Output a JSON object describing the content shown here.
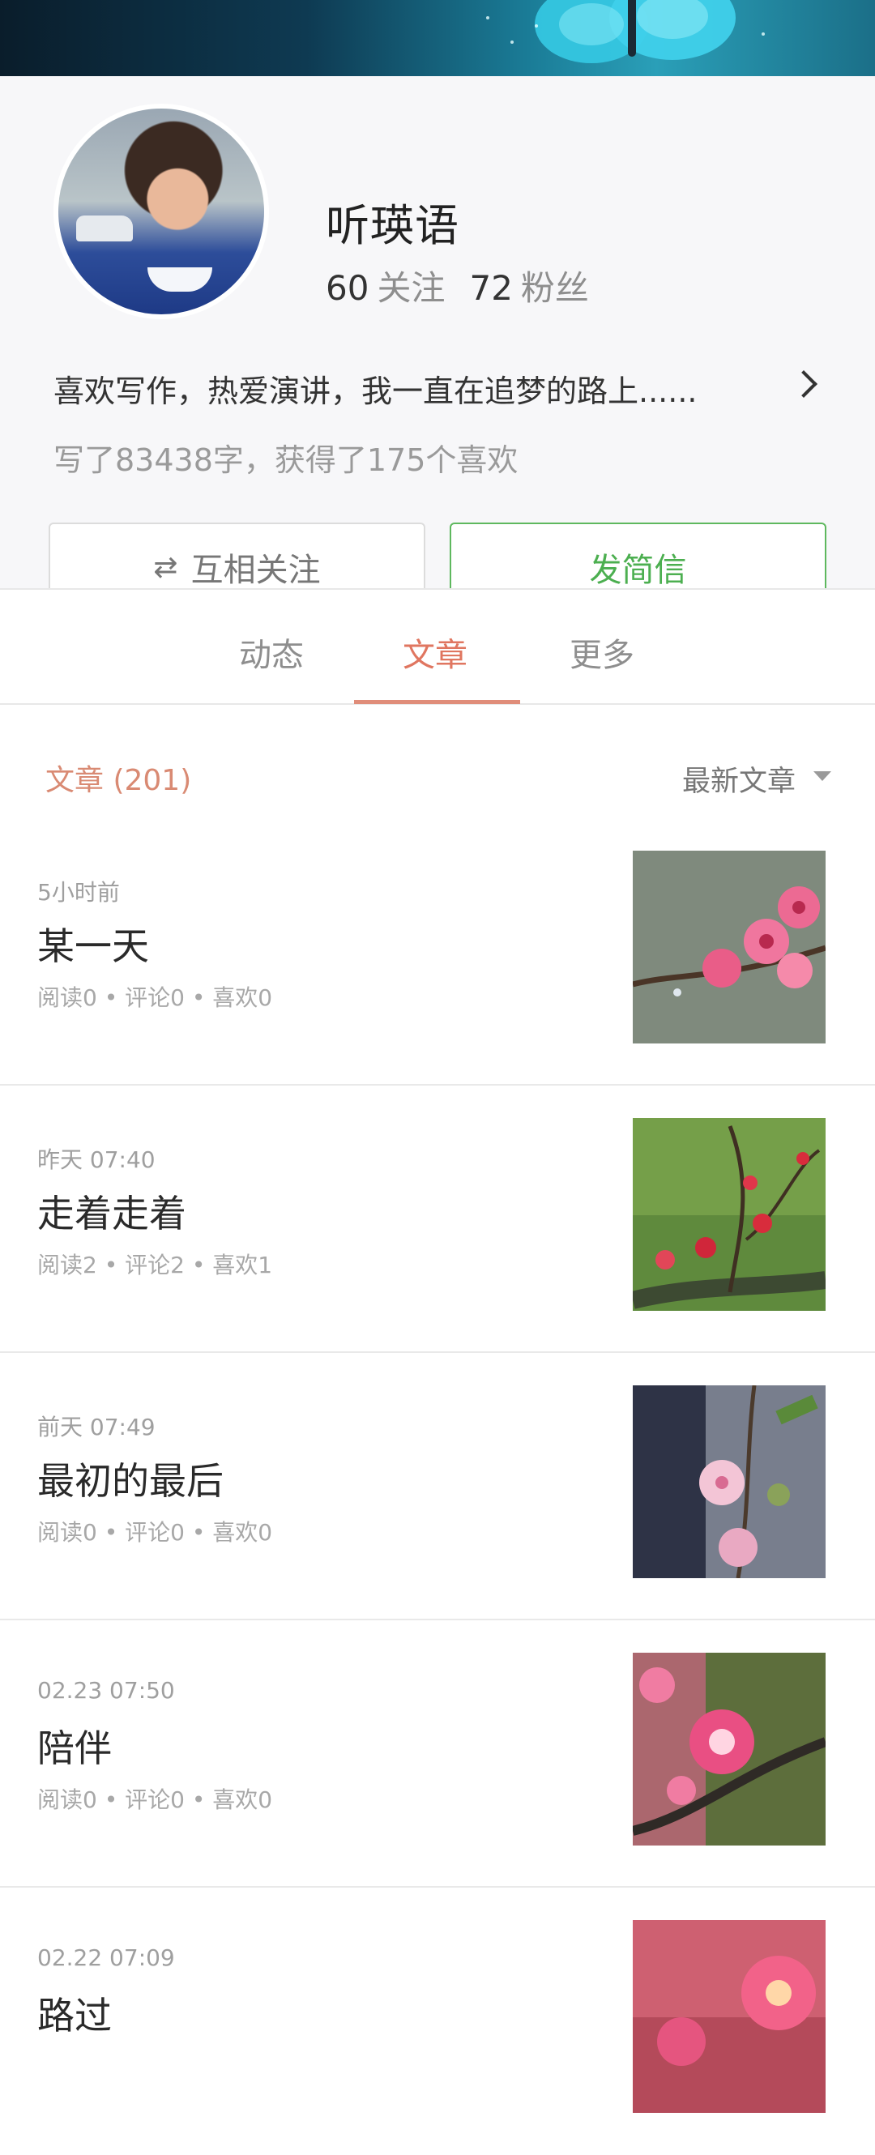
{
  "profile": {
    "name": "听瑛语",
    "following_count": "60",
    "following_label": "关注",
    "followers_count": "72",
    "followers_label": "粉丝",
    "bio": "喜欢写作，热爱演讲，我一直在追梦的路上......",
    "summary": "写了83438字，获得了175个喜欢"
  },
  "actions": {
    "mutual_follow_icon": "⇄",
    "mutual_follow_label": "互相关注",
    "message_label": "发简信"
  },
  "tabs": [
    {
      "label": "动态"
    },
    {
      "label": "文章"
    },
    {
      "label": "更多"
    }
  ],
  "section": {
    "count_label": "文章 (201)",
    "sort_label": "最新文章"
  },
  "articles": [
    {
      "time": "5小时前",
      "title": "某一天",
      "meta": "阅读0 • 评论0 • 喜欢0",
      "thumb": "pink-blossom-branch"
    },
    {
      "time": "昨天 07:40",
      "title": "走着走着",
      "meta": "阅读2 • 评论2 • 喜欢1",
      "thumb": "red-buds-branch"
    },
    {
      "time": "前天 07:49",
      "title": "最初的最后",
      "meta": "阅读0 • 评论0 • 喜欢0",
      "thumb": "pale-pink-flowers"
    },
    {
      "time": "02.23 07:50",
      "title": "陪伴",
      "meta": "阅读0 • 评论0 • 喜欢0",
      "thumb": "plum-blossom"
    },
    {
      "time": "02.22 07:09",
      "title": "路过",
      "meta": "",
      "thumb": "pink-blossom-closeup"
    }
  ],
  "colors": {
    "accent_tab": "#e07660",
    "message_green": "#4caf50"
  }
}
